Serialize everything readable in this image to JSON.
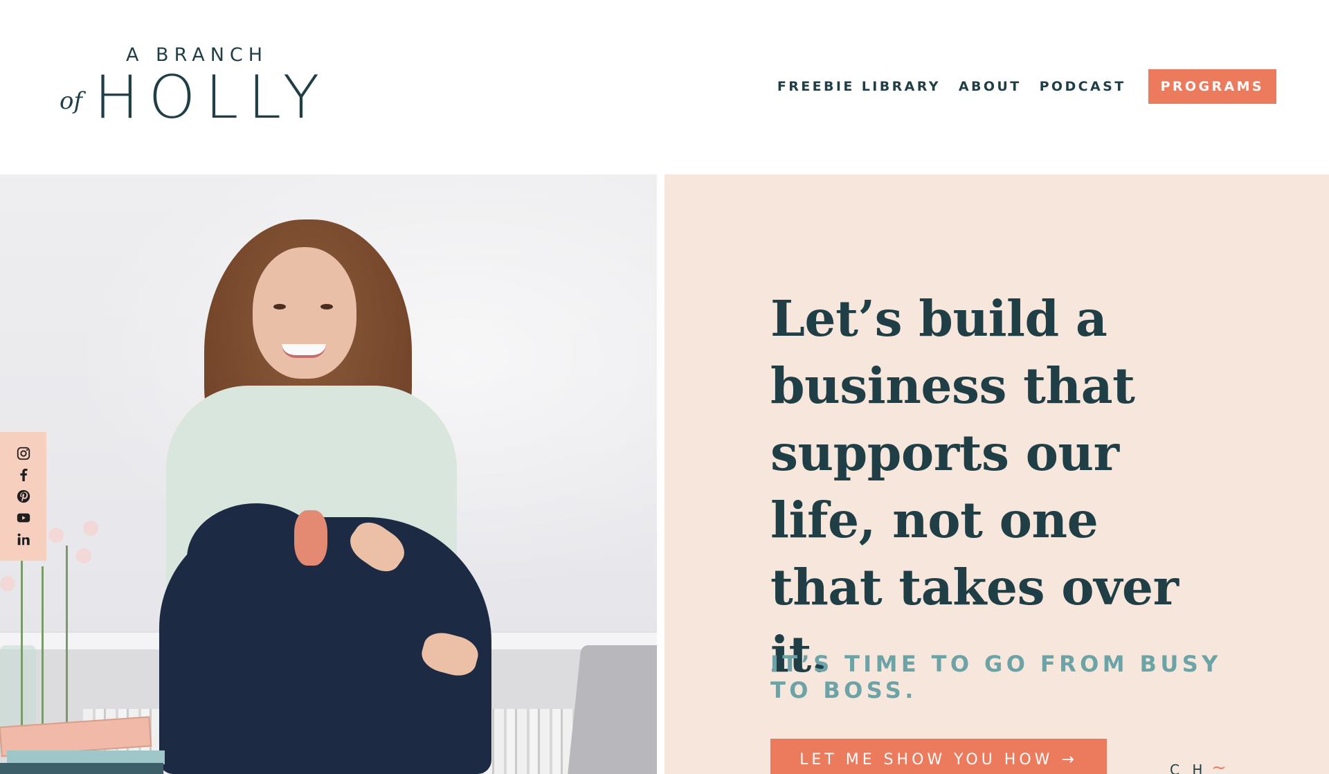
{
  "logo": {
    "line1": "A BRANCH",
    "of": "of",
    "name": "HOLLY"
  },
  "nav": {
    "items": [
      {
        "label": "FREEBIE LIBRARY"
      },
      {
        "label": "ABOUT"
      },
      {
        "label": "PODCAST"
      }
    ],
    "cta": "PROGRAMS"
  },
  "social": {
    "icons": [
      "instagram-icon",
      "facebook-icon",
      "pinterest-icon",
      "youtube-icon",
      "linkedin-icon"
    ]
  },
  "hero": {
    "headline": "Let’s build a business that supports our life, not one that takes over it.",
    "subhead": "IT’S TIME TO GO FROM BUSY TO BOSS.",
    "cta": "LET ME SHOW YOU HOW →",
    "mark": "C H"
  },
  "colors": {
    "brand_dark": "#1f3e46",
    "accent_coral": "#ec7a5c",
    "panel_peach": "#f7e6db",
    "subhead_teal": "#6ba3a6",
    "social_bg": "#f6cfbf"
  }
}
